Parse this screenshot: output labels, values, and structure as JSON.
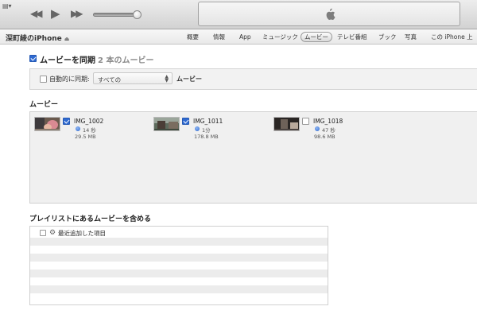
{
  "window": {
    "volume_level": 0.95
  },
  "device": {
    "name": "深町綾のiPhone",
    "eject_icon": "eject-icon"
  },
  "tabs": [
    {
      "label": "概要",
      "active": false
    },
    {
      "label": "情報",
      "active": false
    },
    {
      "label": "App",
      "active": false
    },
    {
      "label": "ミュージック",
      "active": false
    },
    {
      "label": "ムービー",
      "active": true
    },
    {
      "label": "テレビ番組",
      "active": false
    },
    {
      "label": "ブック",
      "active": false
    },
    {
      "label": "写真",
      "active": false
    },
    {
      "label": "この iPhone 上",
      "active": false
    }
  ],
  "sync": {
    "checked": true,
    "label": "ムービーを同期",
    "count": "2 本のムービー"
  },
  "auto_sync": {
    "checked": false,
    "label": "自動的に同期:",
    "selected": "すべての",
    "suffix": "ムービー"
  },
  "movies_section": {
    "title": "ムービー",
    "items": [
      {
        "title": "IMG_1002",
        "duration": "14 秒",
        "size": "29.5 MB",
        "checked": true
      },
      {
        "title": "IMG_1011",
        "duration": "1分",
        "size": "178.8 MB",
        "checked": true
      },
      {
        "title": "IMG_1018",
        "duration": "47 秒",
        "size": "98.6 MB",
        "checked": false
      }
    ]
  },
  "playlists_section": {
    "title": "プレイリストにあるムービーを含める",
    "items": [
      {
        "label": "最近追加した項目",
        "checked": false,
        "icon": "gear-icon"
      }
    ]
  },
  "colors": {
    "accent": "#2f6ad1"
  }
}
